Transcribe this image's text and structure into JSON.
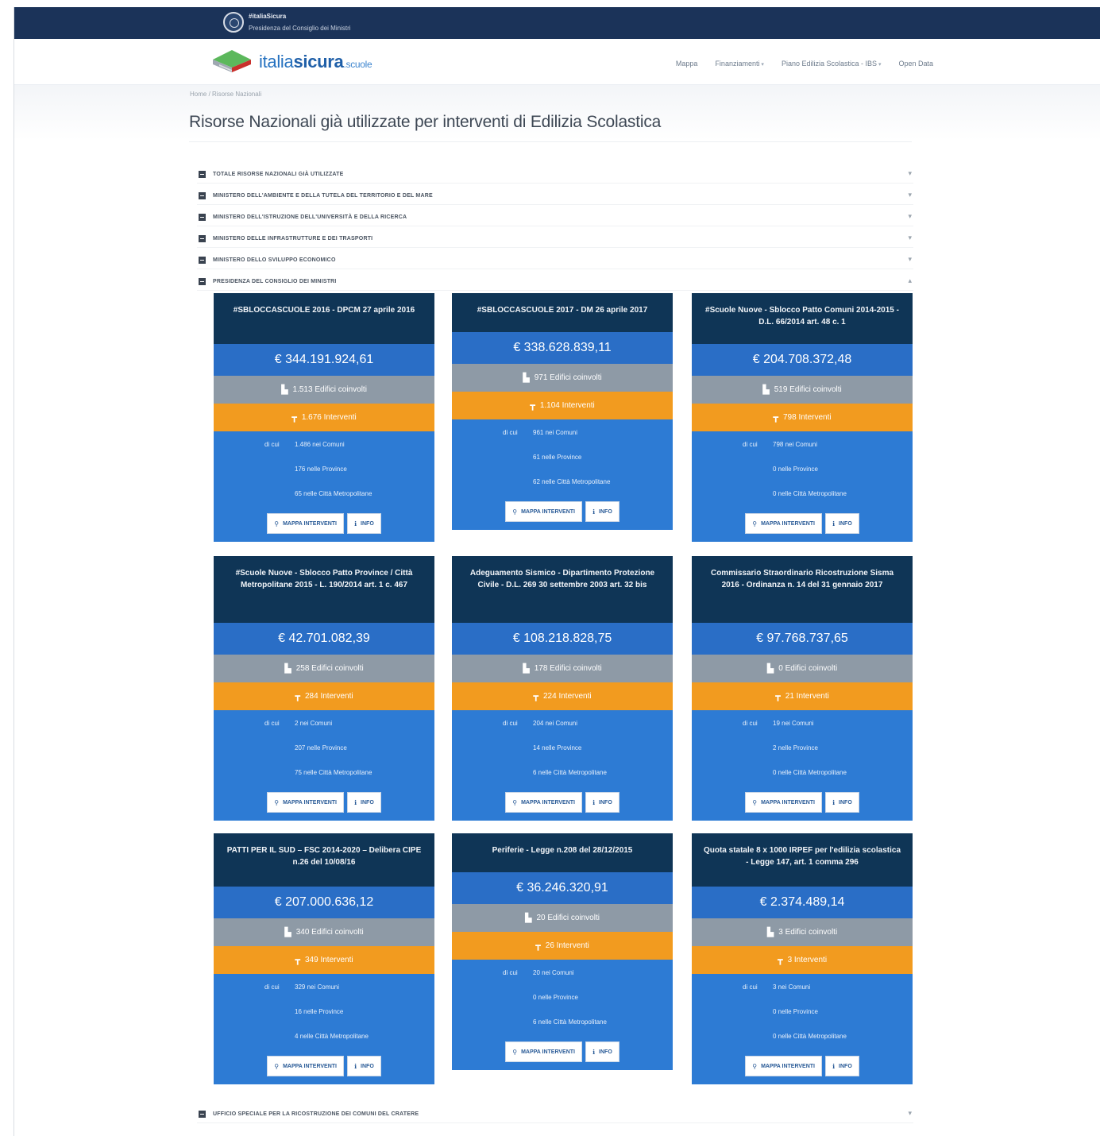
{
  "topbar": {
    "line1": "#italiaSicura",
    "line2": "Presidenza del Consiglio dei Ministri"
  },
  "header": {
    "brand_a": "italia",
    "brand_b": "sicura",
    "brand_c": ".scuole",
    "nav": [
      "Mappa",
      "Finanziamenti",
      "Piano Edilizia Scolastica - IBS",
      "Open Data"
    ]
  },
  "breadcrumb": "Home / Risorse Nazionali",
  "page_title": "Risorse Nazionali già utilizzate per interventi di Edilizia Scolastica",
  "accordion": [
    "TOTALE RISORSE NAZIONALI GIÀ UTILIZZATE",
    "MINISTERO DELL'AMBIENTE E DELLA TUTELA DEL TERRITORIO E DEL MARE",
    "MINISTERO DELL'ISTRUZIONE DELL'UNIVERSITÀ E DELLA RICERCA",
    "MINISTERO DELLE INFRASTRUTTURE E DEI TRASPORTI",
    "MINISTERO DELLO SVILUPPO ECONOMICO",
    "PRESIDENZA DEL CONSIGLIO DEI MINISTRI"
  ],
  "accordion_last": "UFFICIO SPECIALE PER LA RICOSTRUZIONE DEI COMUNI DEL CRATERE",
  "labels": {
    "di_cui": "di cui",
    "mappa": "MAPPA INTERVENTI",
    "info": "INFO"
  },
  "cards": [
    {
      "title": "#SBLOCCASCUOLE 2016 - DPCM 27 aprile 2016",
      "amount": "€ 344.191.924,61",
      "edifici": "1.513 Edifici coinvolti",
      "interventi": "1.676 Interventi",
      "comuni": "1.486 nei Comuni",
      "province": "176 nelle Province",
      "citta": "65 nelle Città Metropolitane"
    },
    {
      "title": "#SBLOCCASCUOLE 2017 - DM 26 aprile 2017",
      "amount": "€ 338.628.839,11",
      "edifici": "971 Edifici coinvolti",
      "interventi": "1.104 Interventi",
      "comuni": "961 nei Comuni",
      "province": "61 nelle Province",
      "citta": "62 nelle Città Metropolitane"
    },
    {
      "title": "#Scuole Nuove - Sblocco Patto Comuni 2014-2015 - D.L. 66/2014 art. 48 c. 1",
      "amount": "€ 204.708.372,48",
      "edifici": "519 Edifici coinvolti",
      "interventi": "798 Interventi",
      "comuni": "798 nei Comuni",
      "province": "0 nelle Province",
      "citta": "0 nelle Città Metropolitane"
    },
    {
      "title": "#Scuole Nuove - Sblocco Patto Province / Città Metropolitane 2015 - L. 190/2014 art. 1 c. 467",
      "amount": "€ 42.701.082,39",
      "edifici": "258 Edifici coinvolti",
      "interventi": "284 Interventi",
      "comuni": "2 nei Comuni",
      "province": "207 nelle Province",
      "citta": "75 nelle Città Metropolitane"
    },
    {
      "title": "Adeguamento Sismico - Dipartimento Protezione Civile - D.L. 269 30 settembre 2003 art. 32 bis",
      "amount": "€ 108.218.828,75",
      "edifici": "178 Edifici coinvolti",
      "interventi": "224 Interventi",
      "comuni": "204 nei Comuni",
      "province": "14 nelle Province",
      "citta": "6 nelle Città Metropolitane"
    },
    {
      "title": "Commissario Straordinario Ricostruzione Sisma 2016 - Ordinanza n. 14 del 31 gennaio 2017",
      "amount": "€ 97.768.737,65",
      "edifici": "0 Edifici coinvolti",
      "interventi": "21 Interventi",
      "comuni": "19 nei Comuni",
      "province": "2 nelle Province",
      "citta": "0 nelle Città Metropolitane"
    },
    {
      "title": "PATTI PER IL SUD – FSC 2014-2020 – Delibera CIPE n.26 del 10/08/16",
      "amount": "€ 207.000.636,12",
      "edifici": "340 Edifici coinvolti",
      "interventi": "349 Interventi",
      "comuni": "329 nei Comuni",
      "province": "16 nelle Province",
      "citta": "4 nelle Città Metropolitane"
    },
    {
      "title": "Periferie - Legge n.208 del 28/12/2015",
      "amount": "€ 36.246.320,91",
      "edifici": "20 Edifici coinvolti",
      "interventi": "26 Interventi",
      "comuni": "20 nei Comuni",
      "province": "0 nelle Province",
      "citta": "6 nelle Città Metropolitane"
    },
    {
      "title": "Quota statale 8 x 1000 IRPEF per l'edilizia scolastica - Legge 147, art. 1 comma 296",
      "amount": "€ 2.374.489,14",
      "edifici": "3 Edifici coinvolti",
      "interventi": "3 Interventi",
      "comuni": "3 nei Comuni",
      "province": "0 nelle Province",
      "citta": "0 nelle Città Metropolitane"
    }
  ]
}
